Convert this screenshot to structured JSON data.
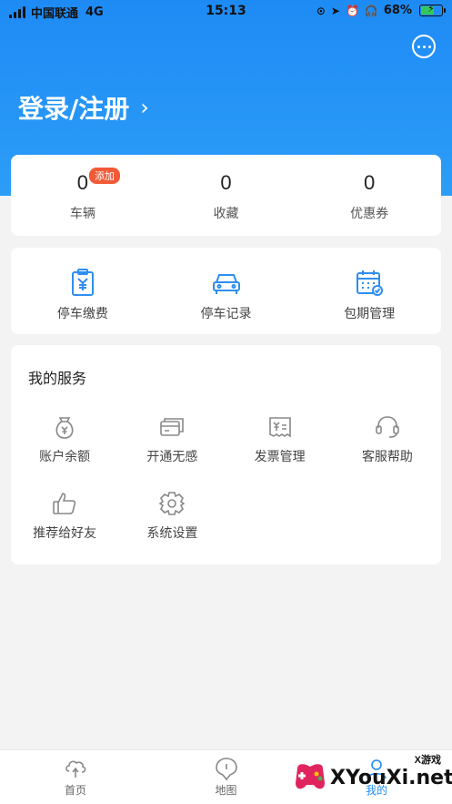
{
  "status_bar": {
    "carrier": "中国联通",
    "network": "4G",
    "time": "15:13",
    "battery": "68%",
    "battery_level": 0.68
  },
  "header": {
    "login_label": "登录/注册",
    "message_icon": "chat-bubble-icon"
  },
  "stats": [
    {
      "value": "0",
      "label": "车辆",
      "badge": "添加"
    },
    {
      "value": "0",
      "label": "收藏"
    },
    {
      "value": "0",
      "label": "优惠券"
    }
  ],
  "quick_actions": [
    {
      "label": "停车缴费",
      "icon": "parking-fee-icon"
    },
    {
      "label": "停车记录",
      "icon": "car-icon"
    },
    {
      "label": "包期管理",
      "icon": "calendar-icon"
    }
  ],
  "services": {
    "title": "我的服务",
    "items": [
      {
        "label": "账户余额",
        "icon": "money-bag-icon"
      },
      {
        "label": "开通无感",
        "icon": "card-icon"
      },
      {
        "label": "发票管理",
        "icon": "invoice-icon"
      },
      {
        "label": "客服帮助",
        "icon": "headset-icon"
      },
      {
        "label": "推荐给好友",
        "icon": "thumbs-up-icon"
      },
      {
        "label": "系统设置",
        "icon": "gear-icon"
      }
    ]
  },
  "tabbar": [
    {
      "label": "首页",
      "icon": "home-icon"
    },
    {
      "label": "地图",
      "icon": "map-pin-icon"
    },
    {
      "label": "我的",
      "icon": "profile-icon",
      "active": true
    }
  ],
  "watermark": {
    "text": "XYouXi.net",
    "small": "X游戏"
  },
  "colors": {
    "accent": "#1e8bf5",
    "badge": "#f25a37",
    "background": "#f3f3f3"
  }
}
